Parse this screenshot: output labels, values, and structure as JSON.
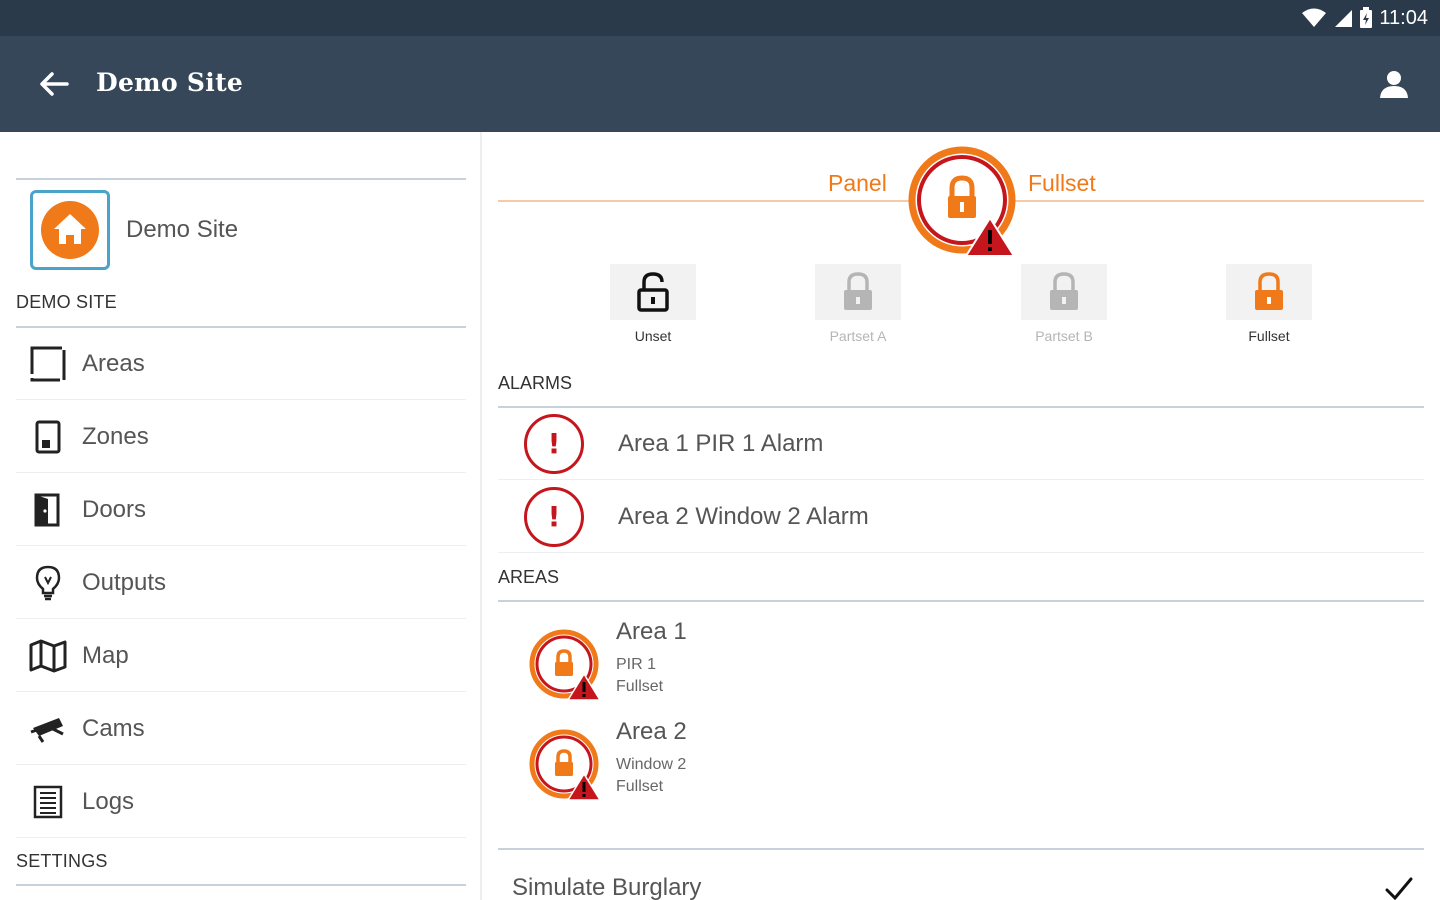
{
  "statusbar": {
    "time": "11:04"
  },
  "appbar": {
    "title": "Demo Site"
  },
  "sidebar": {
    "site": {
      "name": "Demo Site"
    },
    "section_site": "DEMO SITE",
    "items": [
      {
        "label": "Areas",
        "icon": "areas-icon"
      },
      {
        "label": "Zones",
        "icon": "zones-icon"
      },
      {
        "label": "Doors",
        "icon": "doors-icon"
      },
      {
        "label": "Outputs",
        "icon": "outputs-icon"
      },
      {
        "label": "Map",
        "icon": "map-icon"
      },
      {
        "label": "Cams",
        "icon": "cams-icon"
      },
      {
        "label": "Logs",
        "icon": "logs-icon"
      }
    ],
    "section_settings": "SETTINGS"
  },
  "panel": {
    "left_label": "Panel",
    "right_label": "Fullset",
    "accent": "#f07a1a",
    "alert": "#c4161c"
  },
  "modes": [
    {
      "label": "Unset",
      "active": true
    },
    {
      "label": "Partset A",
      "active": false
    },
    {
      "label": "Partset B",
      "active": false
    },
    {
      "label": "Fullset",
      "active": true
    }
  ],
  "alarms": {
    "header": "ALARMS",
    "items": [
      {
        "label": "Area 1 PIR 1 Alarm"
      },
      {
        "label": "Area 2 Window 2 Alarm"
      }
    ]
  },
  "areas": {
    "header": "AREAS",
    "items": [
      {
        "name": "Area 1",
        "zone": "PIR 1",
        "state": "Fullset"
      },
      {
        "name": "Area 2",
        "zone": "Window 2",
        "state": "Fullset"
      }
    ]
  },
  "simulate": {
    "label": "Simulate Burglary"
  }
}
